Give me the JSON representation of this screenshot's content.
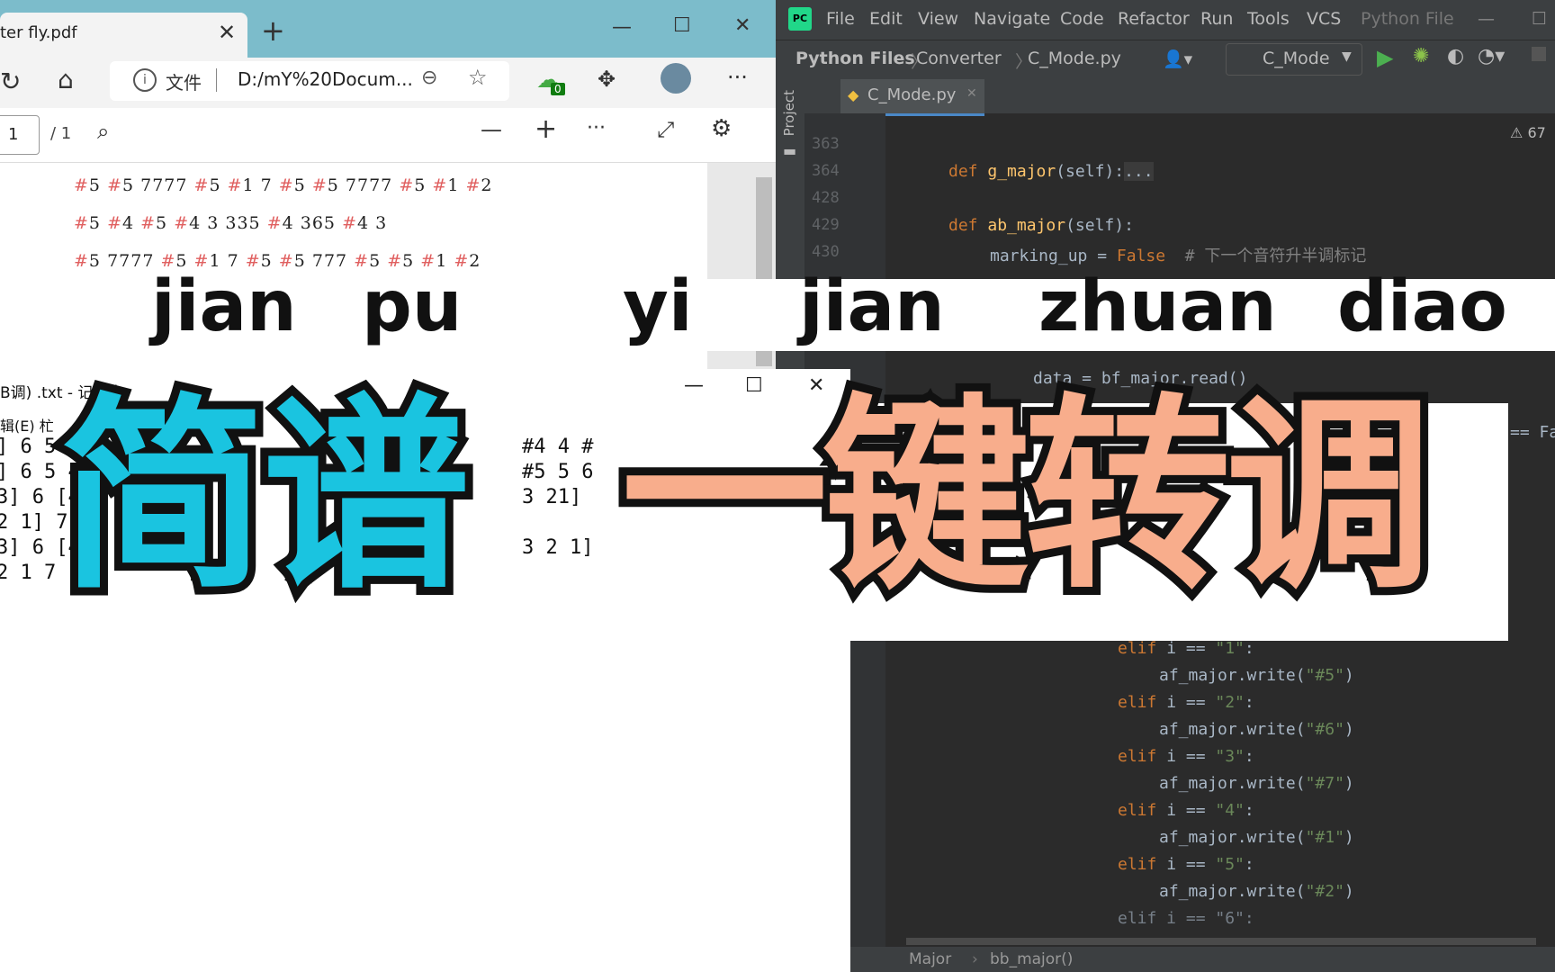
{
  "browser": {
    "tab_title": "ter fly.pdf",
    "address_prefix": "文件",
    "address_url": "D:/mY%20Docum...",
    "badge_count": "0",
    "page_current": "1",
    "page_total": "/ 1",
    "score_lines": [
      [
        [
          "#",
          "5"
        ],
        [
          "#",
          "5"
        ],
        [
          "",
          "7777"
        ],
        [
          "#",
          "5"
        ],
        [
          "#",
          "1"
        ],
        [
          "",
          "7 "
        ],
        [
          "#",
          "5"
        ],
        [
          "#",
          "5"
        ],
        [
          "",
          "7777"
        ],
        [
          "#",
          "5"
        ],
        [
          "#",
          "1"
        ],
        [
          "#",
          "2"
        ]
      ],
      [
        [
          "#",
          "5"
        ],
        [
          "#",
          "4"
        ],
        [
          "#",
          "5"
        ],
        [
          "#",
          "4"
        ],
        [
          "",
          "3   335"
        ],
        [
          "#",
          "4"
        ],
        [
          "",
          "365"
        ],
        [
          "#",
          "4"
        ],
        [
          "",
          "3"
        ]
      ],
      [
        [
          "#",
          "5"
        ],
        [
          "",
          "7777"
        ],
        [
          "#",
          "5"
        ],
        [
          "#",
          "1"
        ],
        [
          "",
          "7 "
        ],
        [
          "#",
          "5"
        ],
        [
          "#",
          "5"
        ],
        [
          "",
          "777"
        ],
        [
          "#",
          "5"
        ],
        [
          "#",
          "5"
        ],
        [
          "#",
          "1"
        ],
        [
          "#",
          "2"
        ]
      ]
    ]
  },
  "ide": {
    "menu": [
      "File",
      "Edit",
      "View",
      "Navigate",
      "Code",
      "Refactor",
      "Run",
      "Tools",
      "VCS"
    ],
    "menu_context": "Python File",
    "breadcrumbs": [
      "Python Files",
      "Converter",
      "C_Mode.py"
    ],
    "run_config": "C_Mode",
    "project_label": "Project",
    "editor_tab": "C_Mode.py",
    "warnings": "67",
    "line_numbers": [
      "363",
      "364",
      "428",
      "429",
      "430"
    ],
    "code": {
      "l_def_g": "def ",
      "l_g_name": "g_major",
      "l_g_args": "(self):",
      "l_g_fold": "...",
      "l_def_ab": "def ",
      "l_ab_name": "ab_major",
      "l_ab_args": "(self):",
      "l_marking": "marking_up = ",
      "l_false": "False",
      "l_comment": "  # 下一个音符升半调标记",
      "l_data": "data = bf_major.read()",
      "l_fa": "== Fa",
      "elif_rows": [
        {
          "cond": "\"1\"",
          "out": "\"#5\""
        },
        {
          "cond": "\"2\"",
          "out": "\"#6\""
        },
        {
          "cond": "\"3\"",
          "out": "\"#7\""
        },
        {
          "cond": "\"4\"",
          "out": "\"#1\""
        },
        {
          "cond": "\"5\"",
          "out": "\"#2\""
        }
      ],
      "elif_kw": "elif ",
      "elif_mid": "i == ",
      "write_call": "af_major.write(",
      "close": ")",
      "colon": ":",
      "last_partial": "elif i == \"6\":"
    },
    "status_crumbs": [
      "Major",
      "bb_major()"
    ]
  },
  "notepad": {
    "title": "B调) .txt - 记事本",
    "menu_partial": "辑(E)  杧",
    "left_lines": [
      "] 6 5 4",
      "] 6 5 4",
      "3] 6 [4",
      "2 1] 7",
      "3] 6 [4",
      "2 1 7"
    ],
    "right_lines": [
      "#4 4 #",
      "#5 5 6",
      "3 21]",
      "",
      "3 2 1]",
      ""
    ]
  },
  "overlay": {
    "pinyin": [
      "jian",
      "pu",
      "yi",
      "jian",
      "zhuan",
      "diao"
    ],
    "title_blue": "简谱",
    "title_orange": "一键转调"
  },
  "colors": {
    "blue_title": "#1ac4e0",
    "orange_title": "#f8ad8c",
    "browser_tabbar": "#7cbccb",
    "ide_bg": "#2b2b2b"
  }
}
